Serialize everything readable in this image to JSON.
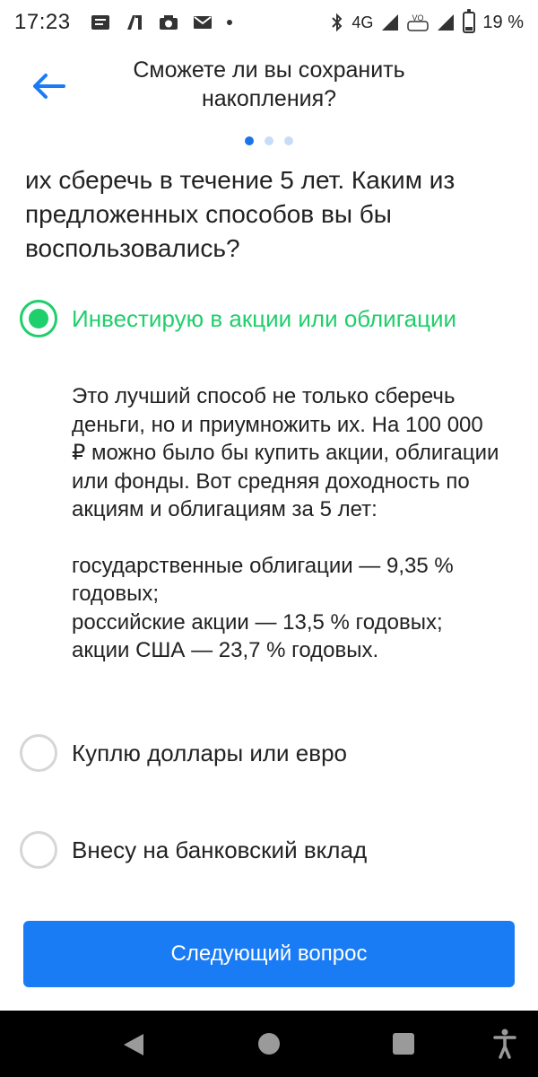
{
  "status_bar": {
    "time": "17:23",
    "network": "4G",
    "battery": "19 %",
    "battery_level": 0.19
  },
  "header": {
    "title": "Сможете ли вы сохранить накопления?"
  },
  "pager": {
    "count": 3,
    "active_index": 0
  },
  "question": {
    "text": "их сберечь в течение 5 лет. Каким из предложенных способов вы бы воспользовались?"
  },
  "options": [
    {
      "label": "Инвестирую в акции или облигации",
      "selected": true
    },
    {
      "label": "Куплю доллары или евро",
      "selected": false
    },
    {
      "label": "Внесу на банковский вклад",
      "selected": false
    }
  ],
  "explanation": {
    "paragraph": "Это лучший способ не только сберечь деньги, но и приумножить их. На 100 000 ₽ можно было бы купить акции, облигации или фонды. Вот средняя доходность по акциям и облигациям за 5 лет:",
    "lines": [
      "государственные облигации — 9,35 % годовых;",
      "российские акции — 13,5 % годовых;",
      "акции США — 23,7 % годовых."
    ]
  },
  "next_button": {
    "label": "Следующий вопрос"
  },
  "colors": {
    "accent_blue": "#1a7cf5",
    "selected_green": "#1fcf6b",
    "text": "#222222"
  }
}
